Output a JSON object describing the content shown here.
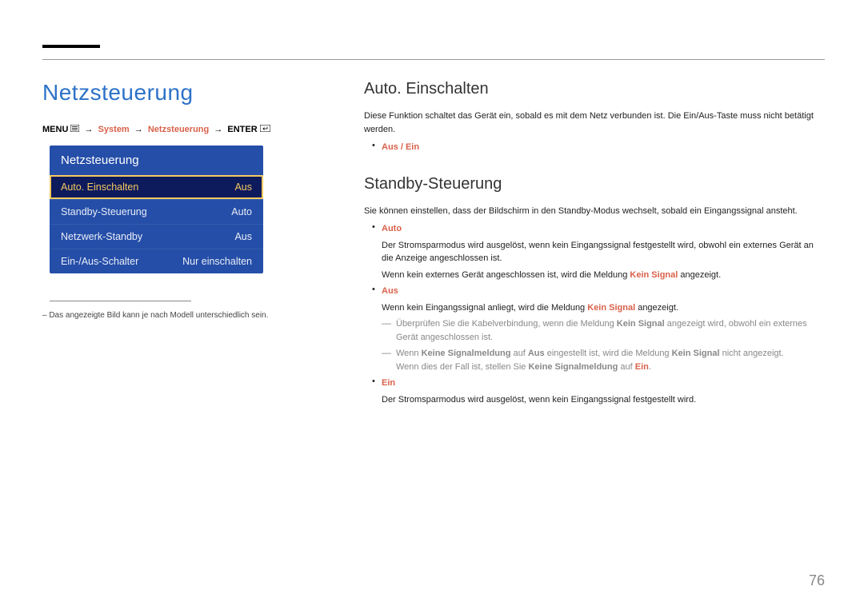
{
  "pageNumber": "76",
  "mainTitle": "Netzsteuerung",
  "breadcrumb": {
    "menu": "MENU",
    "system": "System",
    "netzsteuerung": "Netzsteuerung",
    "enter": "ENTER"
  },
  "menuBox": {
    "header": "Netzsteuerung",
    "items": [
      {
        "label": "Auto. Einschalten",
        "value": "Aus",
        "selected": true
      },
      {
        "label": "Standby-Steuerung",
        "value": "Auto",
        "selected": false
      },
      {
        "label": "Netzwerk-Standby",
        "value": "Aus",
        "selected": false
      },
      {
        "label": "Ein-/Aus-Schalter",
        "value": "Nur einschalten",
        "selected": false
      }
    ]
  },
  "menuNote": "– Das angezeigte Bild kann je nach Modell unterschiedlich sein.",
  "section1": {
    "title": "Auto. Einschalten",
    "body": "Diese Funktion schaltet das Gerät ein, sobald es mit dem Netz verbunden ist. Die Ein/Aus-Taste muss nicht betätigt werden.",
    "bullet": "Aus / Ein"
  },
  "section2": {
    "title": "Standby-Steuerung",
    "body": "Sie können einstellen, dass der Bildschirm in den Standby-Modus wechselt, sobald ein Eingangssignal ansteht.",
    "auto": {
      "label": "Auto",
      "line1": "Der Stromsparmodus wird ausgelöst, wenn kein Eingangssignal festgestellt wird, obwohl ein externes Gerät an die Anzeige angeschlossen ist.",
      "line2_pre": "Wenn kein externes Gerät angeschlossen ist, wird die Meldung ",
      "line2_kein": "Kein Signal",
      "line2_post": " angezeigt."
    },
    "aus": {
      "label": "Aus",
      "line1_pre": "Wenn kein Eingangssignal anliegt, wird die Meldung ",
      "line1_kein": "Kein Signal",
      "line1_post": " angezeigt.",
      "dash1_pre": "Überprüfen Sie die Kabelverbindung, wenn die Meldung ",
      "dash1_kein": "Kein Signal",
      "dash1_post": " angezeigt wird, obwohl ein externes Gerät angeschlossen ist.",
      "dash2_p1": "Wenn ",
      "dash2_ksm1": "Keine Signalmeldung",
      "dash2_p2": " auf ",
      "dash2_aus": "Aus",
      "dash2_p3": " eingestellt ist, wird die Meldung ",
      "dash2_kein": "Kein Signal",
      "dash2_p4": " nicht angezeigt.",
      "dash2b_p1": "Wenn dies der Fall ist, stellen Sie ",
      "dash2b_ksm": "Keine Signalmeldung",
      "dash2b_p2": " auf ",
      "dash2b_ein": "Ein",
      "dash2b_p3": "."
    },
    "ein": {
      "label": "Ein",
      "line1": "Der Stromsparmodus wird ausgelöst, wenn kein Eingangssignal festgestellt wird."
    }
  }
}
